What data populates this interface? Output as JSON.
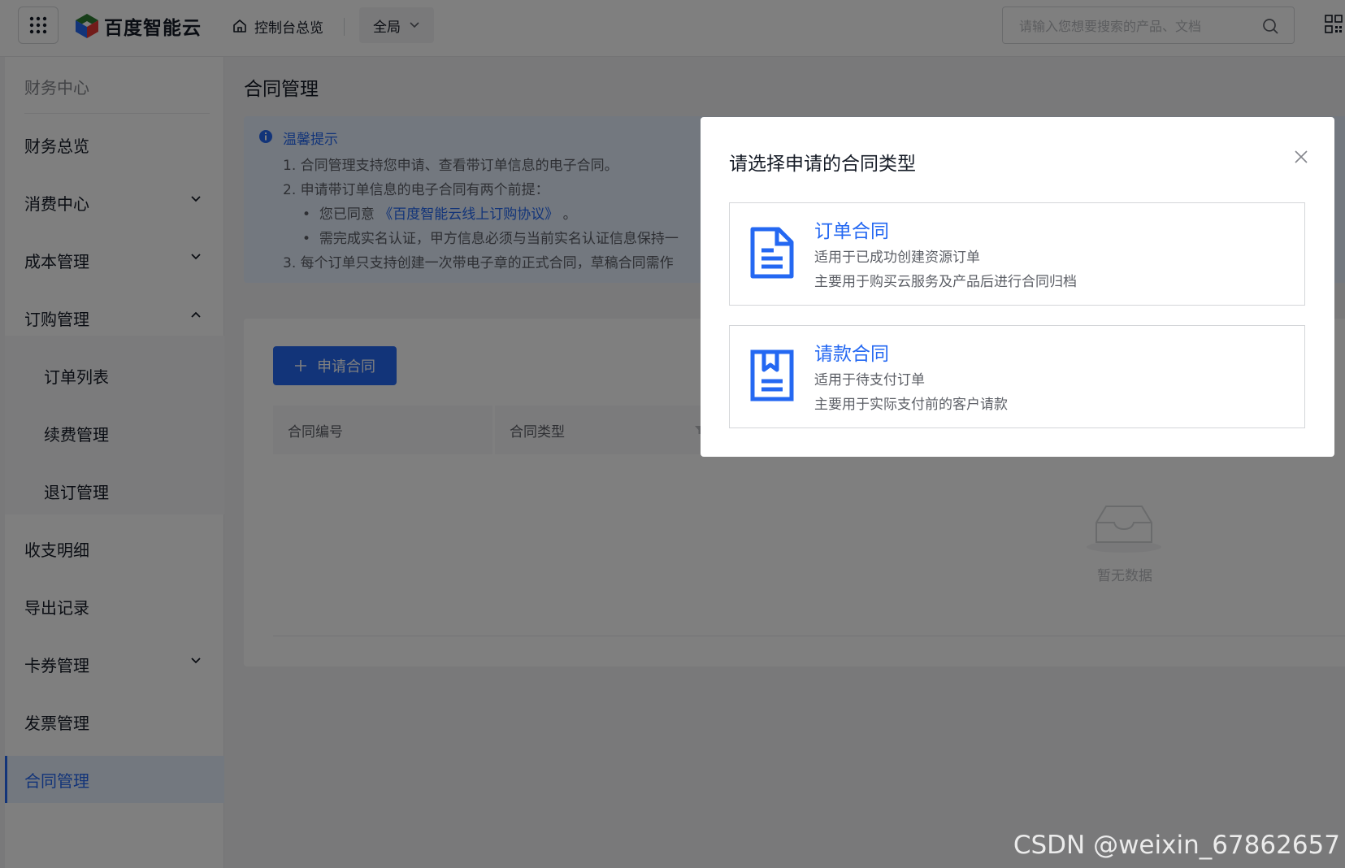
{
  "topbar": {
    "logo_text": "百度智能云",
    "console_home": "控制台总览",
    "region": "全局",
    "search_placeholder": "请输入您想要搜索的产品、文档"
  },
  "sidebar": {
    "title": "财务中心",
    "items": [
      {
        "label": "财务总览"
      },
      {
        "label": "消费中心"
      },
      {
        "label": "成本管理"
      },
      {
        "label": "订购管理"
      },
      {
        "label": "订单列表"
      },
      {
        "label": "续费管理"
      },
      {
        "label": "退订管理"
      },
      {
        "label": "收支明细"
      },
      {
        "label": "导出记录"
      },
      {
        "label": "卡券管理"
      },
      {
        "label": "发票管理"
      },
      {
        "label": "合同管理"
      }
    ]
  },
  "main": {
    "page_title": "合同管理",
    "notice": {
      "title": "温馨提示",
      "line1": "1. 合同管理支持您申请、查看带订单信息的电子合同。",
      "line2": "2. 申请带订单信息的电子合同有两个前提：",
      "line3_prefix": "您已同意",
      "line3_link": "《百度智能云线上订购协议》",
      "line3_suffix": "。",
      "line4": "需完成实名认证，甲方信息必须与当前实名认证信息保持一",
      "line5": "3. 每个订单只支持创建一次带电子章的正式合同，草稿合同需作"
    },
    "apply_button": "申请合同",
    "table_headers": [
      "合同编号",
      "合同类型"
    ],
    "empty_text": "暂无数据"
  },
  "modal": {
    "title": "请选择申请的合同类型",
    "options": [
      {
        "name": "订单合同",
        "desc1": "适用于已成功创建资源订单",
        "desc2": "主要用于购买云服务及产品后进行合同归档"
      },
      {
        "name": "请款合同",
        "desc1": "适用于待支付订单",
        "desc2": "主要用于实际支付前的客户请款"
      }
    ]
  },
  "watermark": "CSDN @weixin_67862657",
  "colors": {
    "accent": "#2468f2",
    "mask": "rgba(0,0,0,0.5)"
  },
  "icons": [
    "apps-grid-icon",
    "home-icon",
    "chevron-down-icon",
    "search-icon",
    "qr-code-icon",
    "info-icon",
    "plus-icon",
    "filter-icon",
    "empty-box-icon",
    "close-icon",
    "document-icon",
    "bookmark-document-icon"
  ]
}
